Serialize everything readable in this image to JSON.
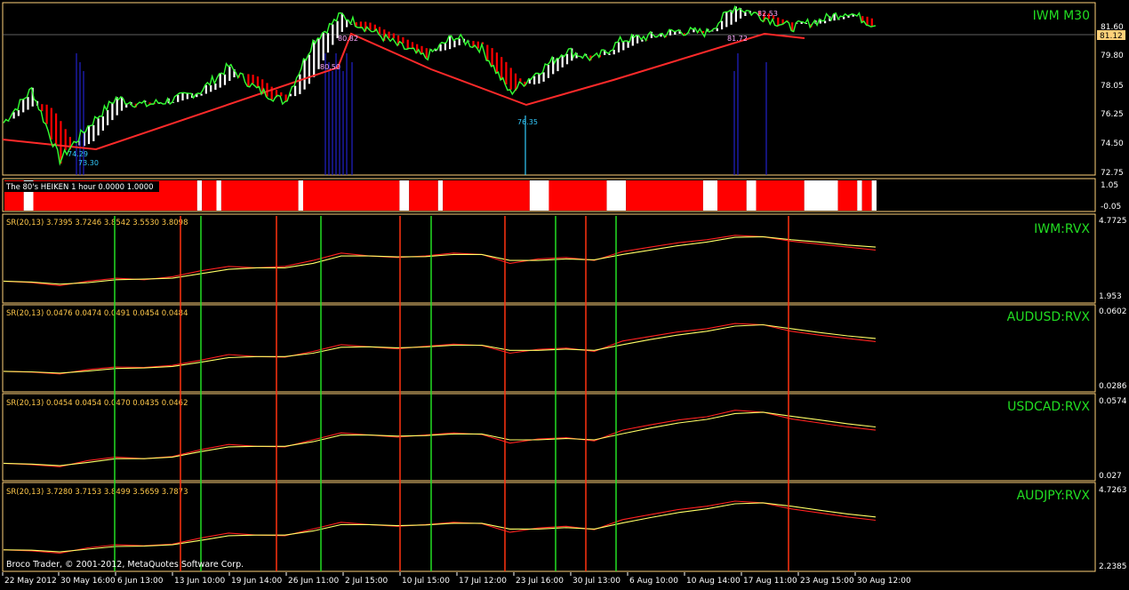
{
  "colors": {
    "background": "#000000",
    "frame": "#ffd27a",
    "grid_text": "#ffffff",
    "price_line": "#33ff33",
    "heiken_up": "#ffffff",
    "heiken_down": "#ff0000",
    "trend_line": "#ff2a2a",
    "spike": "#2222cc",
    "cyan_label": "#33ccff",
    "rvx_red": "#ff2020",
    "rvx_yellow": "#ffff66",
    "vline_green": "#22dd22",
    "vline_red": "#ff3311",
    "info_text": "#ffc84a",
    "title_green": "#22dd22",
    "current_price_bg": "#ffd27a"
  },
  "main": {
    "title": "IWM M30",
    "price_ticks": [
      "81.60",
      "79.80",
      "78.05",
      "76.25",
      "74.50",
      "72.75"
    ],
    "current_price": "81.12",
    "low_labels": [
      "74.29",
      "73.30"
    ],
    "mid_label": "76.35",
    "high_labels": [
      "80.50",
      "80.82",
      "81.72",
      "82.53"
    ]
  },
  "heiken": {
    "label": "The 80's HEIKEN 1 hour 0.0000 1.0000",
    "ticks": [
      "1.05",
      "-0.05"
    ],
    "segments": [
      "red",
      "white",
      "red",
      "white",
      "red",
      "white",
      "red",
      "white",
      "red",
      "white",
      "red",
      "white",
      "red",
      "white",
      "red",
      "white",
      "red",
      "white",
      "red",
      "white",
      "red",
      "white",
      "red",
      "white",
      "red",
      "white"
    ]
  },
  "panels": [
    {
      "title": "IWM:RVX",
      "info": "SR(20,13) 3.7395 3.7246 3.8542 3.5530 3.8098",
      "scale_top": "4.7725",
      "scale_bottom": "1.953"
    },
    {
      "title": "AUDUSD:RVX",
      "info": "SR(20,13) 0.0476 0.0474 0.0491 0.0454 0.0484",
      "scale_top": "0.0602",
      "scale_bottom": "0.0286"
    },
    {
      "title": "USDCAD:RVX",
      "info": "SR(20,13) 0.0454 0.0454 0.0470 0.0435 0.0462",
      "scale_top": "0.0574",
      "scale_bottom": "0.027"
    },
    {
      "title": "AUDJPY:RVX",
      "info": "SR(20,13) 3.7280 3.7153 3.8499 3.5659 3.7873",
      "scale_top": "4.7263",
      "scale_bottom": "2.2385"
    }
  ],
  "vlines": [
    {
      "x": "30 May 2012 22:00",
      "color": "green"
    },
    {
      "x": "8 Jun 2012 14:00",
      "color": "red"
    },
    {
      "x": "11 Jun 2012 18:00",
      "color": "green"
    },
    {
      "x": "21 Jun 2012 10:00",
      "color": "red"
    },
    {
      "x": "28 Jun 2012 18:00",
      "color": "green"
    },
    {
      "x": "9 Jul 2012 12:00",
      "color": "red"
    },
    {
      "x": "12 Jul 2012 16:00",
      "color": "green"
    },
    {
      "x": "20 Jul 2012 14:00",
      "color": "red"
    },
    {
      "x": "27 Jul 2012 10:00",
      "color": "green"
    },
    {
      "x": "30 Jul 2012 20:00",
      "color": "red"
    },
    {
      "x": "2 Aug 2012 14:00",
      "color": "green"
    },
    {
      "x": "21 Aug 2012 12:00",
      "color": "red"
    }
  ],
  "footer": {
    "copyright": "Broco Trader, © 2001-2012, MetaQuotes Software Corp.",
    "dates": [
      "22 May 2012",
      "30 May 16:00",
      "6 Jun 13:00",
      "13 Jun 10:00",
      "19 Jun 14:00",
      "26 Jun 11:00",
      "2 Jul 15:00",
      "10 Jul 15:00",
      "17 Jul 12:00",
      "23 Jul 16:00",
      "30 Jul 13:00",
      "6 Aug 10:00",
      "10 Aug 14:00",
      "17 Aug 11:00",
      "23 Aug 15:00",
      "30 Aug 12:00"
    ]
  },
  "chart_data": [
    {
      "type": "line",
      "title": "IWM M30",
      "ylim": [
        72.75,
        82.3
      ],
      "x": [
        "22 May",
        "25 May",
        "30 May",
        "2 Jun",
        "6 Jun",
        "10 Jun",
        "13 Jun",
        "16 Jun",
        "19 Jun",
        "22 Jun",
        "26 Jun",
        "29 Jun",
        "2 Jul",
        "6 Jul",
        "10 Jul",
        "13 Jul",
        "17 Jul",
        "20 Jul",
        "23 Jul",
        "26 Jul",
        "30 Jul",
        "2 Aug",
        "6 Aug",
        "8 Aug",
        "10 Aug",
        "14 Aug",
        "17 Aug",
        "20 Aug",
        "23 Aug",
        "27 Aug",
        "30 Aug",
        "31 Aug"
      ],
      "series": [
        {
          "values": [
            75.6,
            77.5,
            73.5,
            75.4,
            77.0,
            76.6,
            76.9,
            77.4,
            78.8,
            77.5,
            76.8,
            80.2,
            81.7,
            80.9,
            80.0,
            79.3,
            80.5,
            79.8,
            77.3,
            78.5,
            79.7,
            79.2,
            80.3,
            80.5,
            80.8,
            80.7,
            82.2,
            81.6,
            81.0,
            81.4,
            81.9,
            81.1
          ]
        }
      ]
    },
    {
      "type": "line",
      "title": "IWM:RVX",
      "ylim": [
        1.953,
        4.7725
      ],
      "x": [
        "22 May",
        "25 May",
        "30 May",
        "2 Jun",
        "6 Jun",
        "10 Jun",
        "13 Jun",
        "16 Jun",
        "19 Jun",
        "22 Jun",
        "26 Jun",
        "29 Jun",
        "2 Jul",
        "6 Jul",
        "10 Jul",
        "13 Jul",
        "17 Jul",
        "20 Jul",
        "23 Jul",
        "26 Jul",
        "30 Jul",
        "2 Aug",
        "6 Aug",
        "8 Aug",
        "10 Aug",
        "14 Aug",
        "17 Aug",
        "20 Aug",
        "23 Aug",
        "27 Aug",
        "30 Aug",
        "31 Aug"
      ],
      "series": [
        {
          "values": [
            2.6,
            2.55,
            2.45,
            2.6,
            2.7,
            2.65,
            2.75,
            2.95,
            3.1,
            3.05,
            3.1,
            3.3,
            3.55,
            3.45,
            3.4,
            3.45,
            3.55,
            3.5,
            3.2,
            3.35,
            3.4,
            3.3,
            3.6,
            3.75,
            3.9,
            4.0,
            4.15,
            4.1,
            3.95,
            3.85,
            3.75,
            3.65
          ]
        },
        {
          "values": [
            2.6,
            2.57,
            2.5,
            2.55,
            2.65,
            2.67,
            2.7,
            2.85,
            3.0,
            3.05,
            3.05,
            3.2,
            3.45,
            3.45,
            3.42,
            3.43,
            3.5,
            3.5,
            3.3,
            3.3,
            3.35,
            3.32,
            3.5,
            3.65,
            3.8,
            3.92,
            4.08,
            4.1,
            4.0,
            3.92,
            3.82,
            3.75
          ]
        }
      ]
    },
    {
      "type": "line",
      "title": "AUDUSD:RVX",
      "ylim": [
        0.0286,
        0.0602
      ],
      "x": [
        "22 May",
        "25 May",
        "30 May",
        "2 Jun",
        "6 Jun",
        "10 Jun",
        "13 Jun",
        "16 Jun",
        "19 Jun",
        "22 Jun",
        "26 Jun",
        "29 Jun",
        "2 Jul",
        "6 Jul",
        "10 Jul",
        "13 Jul",
        "17 Jul",
        "20 Jul",
        "23 Jul",
        "26 Jul",
        "30 Jul",
        "2 Aug",
        "6 Aug",
        "8 Aug",
        "10 Aug",
        "14 Aug",
        "17 Aug",
        "20 Aug",
        "23 Aug",
        "27 Aug",
        "30 Aug",
        "31 Aug"
      ],
      "series": [
        {
          "values": [
            0.0355,
            0.0352,
            0.0345,
            0.0362,
            0.0372,
            0.037,
            0.0378,
            0.0398,
            0.042,
            0.0412,
            0.041,
            0.0432,
            0.0458,
            0.045,
            0.0442,
            0.0452,
            0.046,
            0.0455,
            0.0425,
            0.044,
            0.0445,
            0.0432,
            0.0472,
            0.049,
            0.0508,
            0.052,
            0.054,
            0.0535,
            0.051,
            0.0495,
            0.0482,
            0.047
          ]
        },
        {
          "values": [
            0.0355,
            0.0353,
            0.0348,
            0.0356,
            0.0366,
            0.0368,
            0.0374,
            0.039,
            0.0408,
            0.0412,
            0.0412,
            0.0425,
            0.0448,
            0.045,
            0.0446,
            0.0449,
            0.0456,
            0.0456,
            0.0436,
            0.0436,
            0.0441,
            0.0436,
            0.0458,
            0.0478,
            0.0496,
            0.051,
            0.053,
            0.0535,
            0.052,
            0.0505,
            0.0492,
            0.0482
          ]
        }
      ]
    },
    {
      "type": "line",
      "title": "USDCAD:RVX",
      "ylim": [
        0.027,
        0.0574
      ],
      "x": [
        "22 May",
        "25 May",
        "30 May",
        "2 Jun",
        "6 Jun",
        "10 Jun",
        "13 Jun",
        "16 Jun",
        "19 Jun",
        "22 Jun",
        "26 Jun",
        "29 Jun",
        "2 Jul",
        "6 Jul",
        "10 Jul",
        "13 Jul",
        "17 Jul",
        "20 Jul",
        "23 Jul",
        "26 Jul",
        "30 Jul",
        "2 Aug",
        "6 Aug",
        "8 Aug",
        "10 Aug",
        "14 Aug",
        "17 Aug",
        "20 Aug",
        "23 Aug",
        "27 Aug",
        "30 Aug",
        "31 Aug"
      ],
      "series": [
        {
          "values": [
            0.0325,
            0.032,
            0.0312,
            0.0335,
            0.0348,
            0.0342,
            0.035,
            0.0375,
            0.0395,
            0.0388,
            0.0386,
            0.0412,
            0.0438,
            0.043,
            0.0422,
            0.043,
            0.0438,
            0.0432,
            0.04,
            0.0415,
            0.042,
            0.0408,
            0.0448,
            0.0468,
            0.0486,
            0.0498,
            0.0522,
            0.0515,
            0.049,
            0.0475,
            0.046,
            0.0448
          ]
        },
        {
          "values": [
            0.0325,
            0.0322,
            0.0316,
            0.0328,
            0.0342,
            0.0342,
            0.0348,
            0.0368,
            0.0386,
            0.0388,
            0.0388,
            0.0405,
            0.043,
            0.043,
            0.0426,
            0.0428,
            0.0434,
            0.0434,
            0.0412,
            0.0412,
            0.0417,
            0.0412,
            0.0435,
            0.0456,
            0.0475,
            0.0488,
            0.051,
            0.0515,
            0.05,
            0.0486,
            0.0472,
            0.046
          ]
        }
      ]
    },
    {
      "type": "line",
      "title": "AUDJPY:RVX",
      "ylim": [
        2.2385,
        4.7263
      ],
      "x": [
        "22 May",
        "25 May",
        "30 May",
        "2 Jun",
        "6 Jun",
        "10 Jun",
        "13 Jun",
        "16 Jun",
        "19 Jun",
        "22 Jun",
        "26 Jun",
        "29 Jun",
        "2 Jul",
        "6 Jul",
        "10 Jul",
        "13 Jul",
        "17 Jul",
        "20 Jul",
        "23 Jul",
        "26 Jul",
        "30 Jul",
        "2 Aug",
        "6 Aug",
        "8 Aug",
        "10 Aug",
        "14 Aug",
        "17 Aug",
        "20 Aug",
        "23 Aug",
        "27 Aug",
        "30 Aug",
        "31 Aug"
      ],
      "series": [
        {
          "values": [
            2.8,
            2.77,
            2.7,
            2.86,
            2.95,
            2.92,
            2.97,
            3.15,
            3.3,
            3.24,
            3.22,
            3.42,
            3.62,
            3.55,
            3.5,
            3.55,
            3.62,
            3.58,
            3.32,
            3.45,
            3.5,
            3.4,
            3.7,
            3.85,
            4.0,
            4.1,
            4.25,
            4.2,
            4.02,
            3.9,
            3.78,
            3.68
          ]
        },
        {
          "values": [
            2.8,
            2.79,
            2.74,
            2.82,
            2.9,
            2.91,
            2.95,
            3.08,
            3.22,
            3.24,
            3.24,
            3.36,
            3.55,
            3.55,
            3.52,
            3.54,
            3.59,
            3.59,
            3.42,
            3.42,
            3.46,
            3.42,
            3.6,
            3.76,
            3.91,
            4.02,
            4.17,
            4.2,
            4.1,
            3.98,
            3.87,
            3.78
          ]
        }
      ]
    }
  ]
}
